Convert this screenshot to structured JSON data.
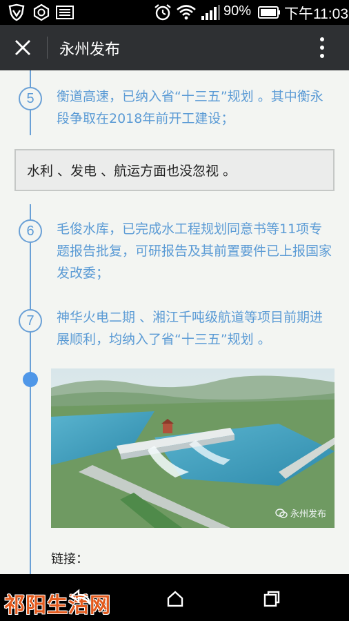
{
  "status_bar": {
    "battery_percent_text": "90%",
    "time_text": "下午11:03",
    "icons": [
      "shield-icon",
      "hexagon-icon",
      "image-icon",
      "alarm-icon",
      "wifi-icon",
      "signal-icon",
      "battery-icon"
    ]
  },
  "app_bar": {
    "title": "永州发布",
    "close_icon": "close-icon",
    "more_icon": "more-vert-icon"
  },
  "content": {
    "steps": [
      {
        "number": "5",
        "text": "衡道高速，已纳入省“十三五”规划 。其中衡永段争取在2018年前开工建设；"
      },
      {
        "number": "6",
        "text": "毛俊水库，已完成水工程规划同意书等11项专题报告批复，可研报告及其前置要件已上报国家发改委；"
      },
      {
        "number": "7",
        "text": "神华火电二期 、湘江千吨级航道等项目前期进展顺利，均纳入了省“十三五”规划 。"
      }
    ],
    "callout_text": "水利 、发电 、航运方面也没忽视 。",
    "photo_watermark": "永州发布",
    "link_label": "链接："
  },
  "nav_bar": {
    "site_logo_text": "祁阳生活网",
    "icons": [
      "back-icon",
      "home-icon",
      "recents-icon"
    ]
  },
  "colors": {
    "accent_blue": "#5b9bd5",
    "app_bar_bg": "#2e3033",
    "page_bg": "#f3f5f2"
  }
}
